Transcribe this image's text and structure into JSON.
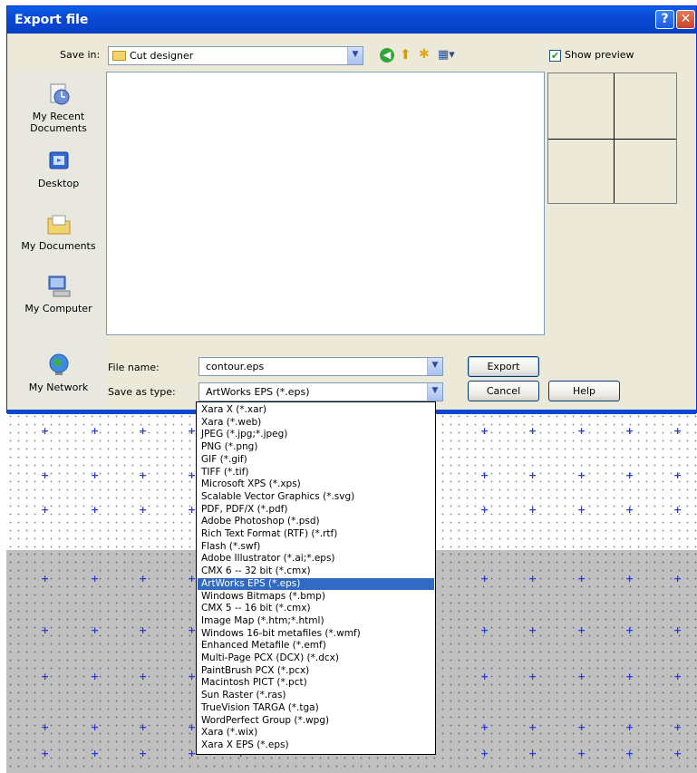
{
  "window": {
    "title": "Export file"
  },
  "toolbar": {
    "save_in_label": "Save in:",
    "save_in_value": "Cut designer",
    "show_preview_label": "Show preview",
    "show_preview_checked": true
  },
  "places": [
    {
      "label": "My Recent Documents",
      "icon": "recent-documents-icon"
    },
    {
      "label": "Desktop",
      "icon": "desktop-icon"
    },
    {
      "label": "My Documents",
      "icon": "my-documents-icon"
    },
    {
      "label": "My Computer",
      "icon": "my-computer-icon"
    },
    {
      "label": "My Network",
      "icon": "my-network-icon"
    }
  ],
  "form": {
    "file_name_label": "File name:",
    "file_name_value": "contour.eps",
    "save_as_type_label": "Save as type:",
    "save_as_type_value": "ArtWorks EPS (*.eps)",
    "export_label": "Export",
    "cancel_label": "Cancel",
    "help_label": "Help"
  },
  "file_types": [
    "Xara X (*.xar)",
    "Xara (*.web)",
    "JPEG (*.jpg;*.jpeg)",
    "PNG (*.png)",
    "GIF (*.gif)",
    "TIFF (*.tif)",
    "Microsoft XPS (*.xps)",
    "Scalable Vector Graphics (*.svg)",
    "PDF, PDF/X (*.pdf)",
    "Adobe Photoshop (*.psd)",
    "Rich Text Format (RTF) (*.rtf)",
    "Flash (*.swf)",
    "Adobe Illustrator (*.ai;*.eps)",
    "CMX 6 -- 32 bit (*.cmx)",
    "ArtWorks EPS (*.eps)",
    "Windows Bitmaps (*.bmp)",
    "CMX 5 -- 16 bit (*.cmx)",
    "Image Map (*.htm;*.html)",
    "Windows 16-bit metafiles (*.wmf)",
    "Enhanced Metafile (*.emf)",
    "Multi-Page PCX (DCX) (*.dcx)",
    "PaintBrush PCX (*.pcx)",
    "Macintosh PICT (*.pct)",
    "Sun Raster (*.ras)",
    "TrueVision TARGA (*.tga)",
    "WordPerfect Group (*.wpg)",
    "Xara (*.wix)",
    "Xara X EPS (*.eps)"
  ],
  "selected_file_type_index": 14,
  "colors": {
    "title_bar": "#0a49d6",
    "selection": "#316ac5",
    "dialog_bg": "#ece9d8"
  }
}
